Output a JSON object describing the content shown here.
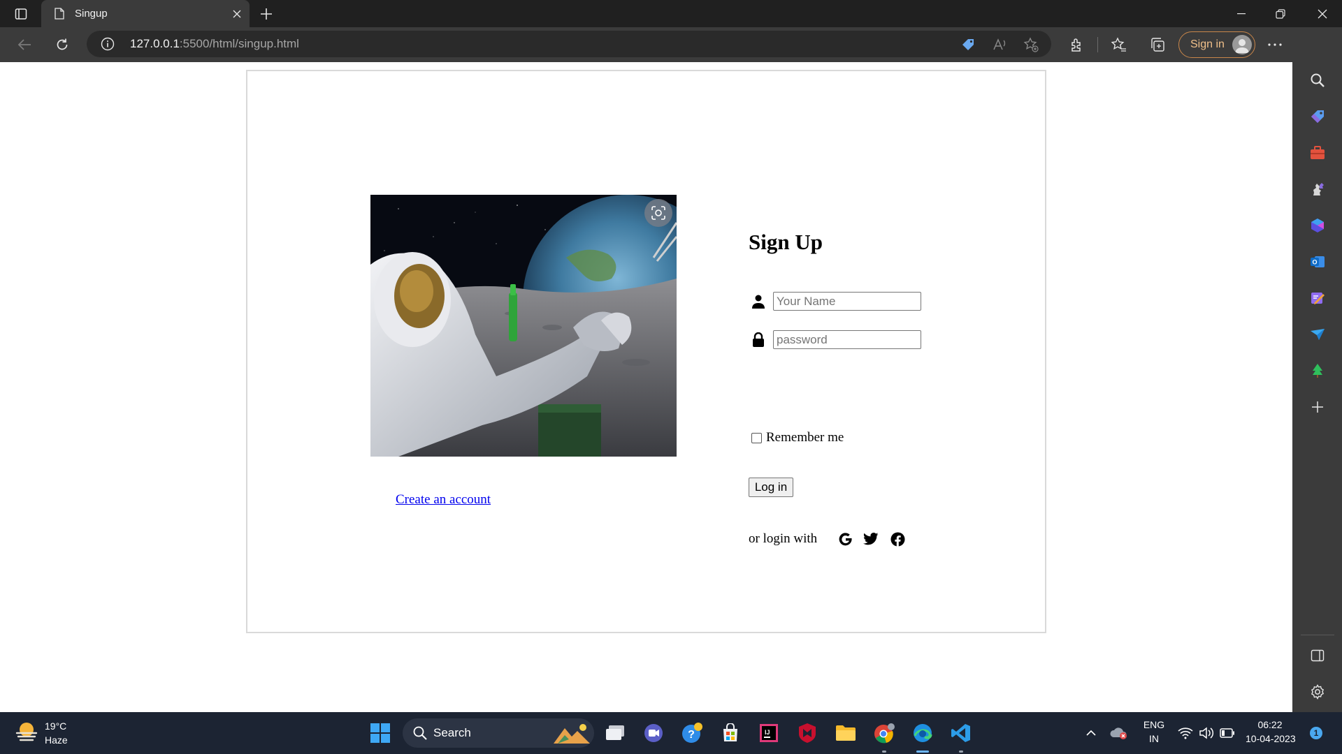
{
  "browser": {
    "tab_title": "Singup",
    "url_host": "127.0.0.1",
    "url_rest": ":5500/html/singup.html",
    "signin_label": "Sign in"
  },
  "page": {
    "title": "Sign Up",
    "name_placeholder": "Your Name",
    "password_placeholder": "password",
    "remember_label": "Remember me",
    "login_button": "Log in",
    "or_login_with": "or login with",
    "create_account": "Create an account",
    "social_icons": [
      "google-icon",
      "twitter-icon",
      "facebook-icon"
    ]
  },
  "taskbar": {
    "weather_temp": "19°C",
    "weather_condition": "Haze",
    "search_label": "Search",
    "lang_primary": "ENG",
    "lang_secondary": "IN",
    "time": "06:22",
    "date": "10-04-2023",
    "notification_count": "1"
  },
  "colors": {
    "chrome_dark": "#202020",
    "chrome_toolbar": "#3b3b3b",
    "taskbar": "#1c2433",
    "link": "#0000ee",
    "signin_accent": "#c8864a"
  }
}
